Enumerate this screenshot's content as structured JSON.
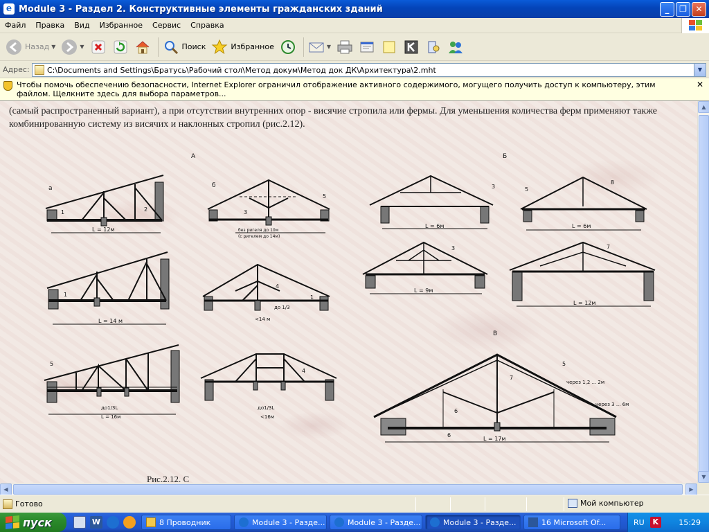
{
  "window": {
    "title": "Module 3 - Раздел 2. Конструктивные элементы гражданских зданий",
    "minimize": "_",
    "maximize": "❐",
    "close": "✕"
  },
  "menu": [
    "Файл",
    "Правка",
    "Вид",
    "Избранное",
    "Сервис",
    "Справка"
  ],
  "toolbar": {
    "back_label": "Назад",
    "search_label": "Поиск",
    "favorites_label": "Избранное"
  },
  "address": {
    "label": "Адрес:",
    "value": "C:\\Documents and Settings\\Братусь\\Рабочий стол\\Метод докум\\Метод док ДК\\Архитектура\\2.mht"
  },
  "infobar": {
    "text": "Чтобы помочь обеспечению безопасности, Internet Explorer ограничил отображение активного содержимого, могущего получить доступ к компьютеру, этим файлом. Щелкните здесь для выбора параметров...",
    "close": "✕"
  },
  "document": {
    "paragraph": "(самый распространенный вариант), а при отсутствии внутренних опор - висячие стропила или фермы. Для уменьшения количества ферм применяют также комбинированную систему из висячих и наклонных стропил (рис.2.12).",
    "caption": "Рис.2.12. С"
  },
  "figure": {
    "group_a": "А",
    "group_b": "Б",
    "group_v": "В",
    "labels": {
      "a": "а",
      "b": "б",
      "d1": "L = 12м",
      "d2": "без ригеля до 10м",
      "d3": "(с ригелем до 14м)",
      "d4": "L = 14 м",
      "d5": "до 1/3",
      "d6": "<14 м",
      "d7": "до1/3L",
      "d8": "L = 16м",
      "d9": "до1/3L",
      "d10": "<16м",
      "d11": "L = 6м",
      "d12": "L = 6м",
      "d13": "L = 9м",
      "d14": "L = 12м",
      "d15": "L = 17м",
      "n1": "1",
      "n2": "2",
      "n3": "3",
      "n4": "4",
      "n5": "5",
      "n6": "6",
      "n7": "7",
      "n8": "8",
      "note1": "через 1,2 ... 2м",
      "note2": "через 3 ... 6м"
    }
  },
  "status": {
    "text": "Готово",
    "zone": "Мой компьютер"
  },
  "taskbar": {
    "start": "пуск",
    "tasks": [
      "8 Проводник",
      "Module 3 - Разде...",
      "Module 3 - Разде...",
      "Module 3 - Разде...",
      "16 Microsoft Of..."
    ],
    "lang": "RU",
    "kas": "K",
    "clock": "15:29"
  }
}
